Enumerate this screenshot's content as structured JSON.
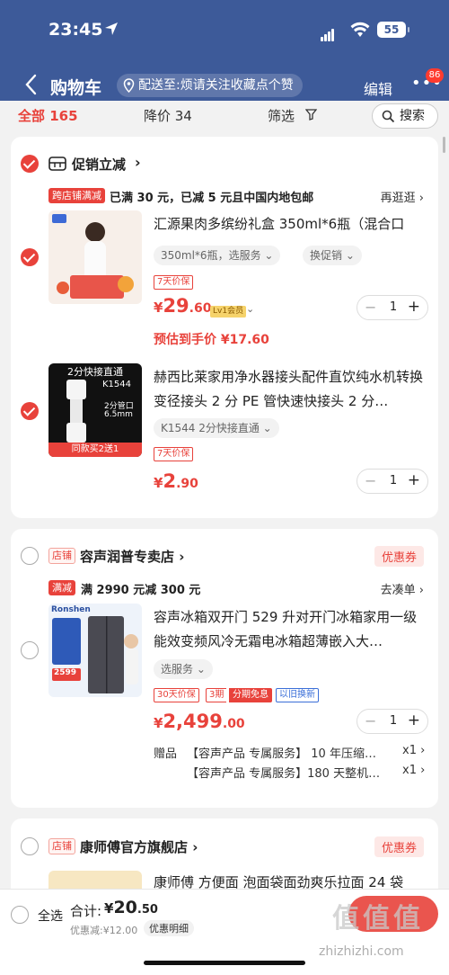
{
  "status_bar": {
    "time": "23:45",
    "battery": "55"
  },
  "nav": {
    "title": "购物车",
    "deliver_to": "配送至:烦请关注收藏点个赞",
    "edit": "编辑",
    "more_badge": "86"
  },
  "tabs": {
    "all": "全部 165",
    "price_drop": "降价 34",
    "filter": "筛选",
    "search": "搜索"
  },
  "card1": {
    "header": "促销立减",
    "promo_tag": "跨店铺满减",
    "promo_text": "已满 30 元，已减 5 元且中国内地包邮",
    "promo_link": "再逛逛 ›",
    "item1": {
      "title": "汇源果肉多缤纷礼盒 350ml*6瓶（混合口",
      "spec": "350ml*6瓶，选服务 ⌄",
      "swap": "换促销 ⌄",
      "tag": "7天价保",
      "price_sym": "¥",
      "price_int": "29",
      "price_dec": ".60",
      "member": "Lv1会员",
      "estimate": "预估到手价 ¥17.60",
      "qty": "1"
    },
    "item2": {
      "title": "赫西比莱家用净水器接头配件直饮纯水机转换变径接头 2 分 PE 管快速快接头 2 分…",
      "spec": "K1544  2分快接直通 ⌄",
      "tag": "7天价保",
      "price_sym": "¥",
      "price_int": "2",
      "price_dec": ".90",
      "qty": "1",
      "img_top": "2分快接直通",
      "img_code": "K1544",
      "img_size1": "2分管口",
      "img_size2": "6.5mm",
      "img_bottom": "同款买2送1"
    }
  },
  "card2": {
    "store_tag": "店铺",
    "store_name": "容声润普专卖店 ›",
    "coupon": "优惠券",
    "promo_tag": "满减",
    "promo_text": "满 2990 元减 300 元",
    "promo_link": "去凑单 ›",
    "item": {
      "title": "容声冰箱双开门 529 升对开门冰箱家用一级能效变频风冷无霜电冰箱超薄嵌入大…",
      "spec": "选服务 ⌄",
      "tag1": "30天价保",
      "tag2a": "3期",
      "tag2b": "分期免息",
      "tag3": "以旧换新",
      "price_sym": "¥",
      "price_int": "2,499",
      "price_dec": ".00",
      "qty": "1",
      "img_brand": "Ronshen",
      "img_price": "2599"
    },
    "gift_label": "赠品",
    "gift1": "【容声产品 专属服务】 10 年压缩…",
    "gift1_qty": "x1 ›",
    "gift2": "【容声产品 专属服务】180 天整机…",
    "gift2_qty": "x1 ›"
  },
  "card3": {
    "store_tag": "店铺",
    "store_name": "康师傅官方旗舰店 ›",
    "coupon": "优惠券",
    "item_title": "康师傅 方便面 泡面袋面劲爽乐拉面 24 袋"
  },
  "bottom_bar": {
    "select_all": "全选",
    "total_label": "合计:",
    "total_sym": "¥",
    "total_int": "20",
    "total_dec": ".50",
    "discount": "优惠减:¥12.00",
    "discount_detail": "优惠明细"
  },
  "watermark": {
    "main": "值值值",
    "site": "zhizhizhi.com"
  },
  "colors": {
    "header": "#3d5a99",
    "accent": "#e8423b"
  }
}
